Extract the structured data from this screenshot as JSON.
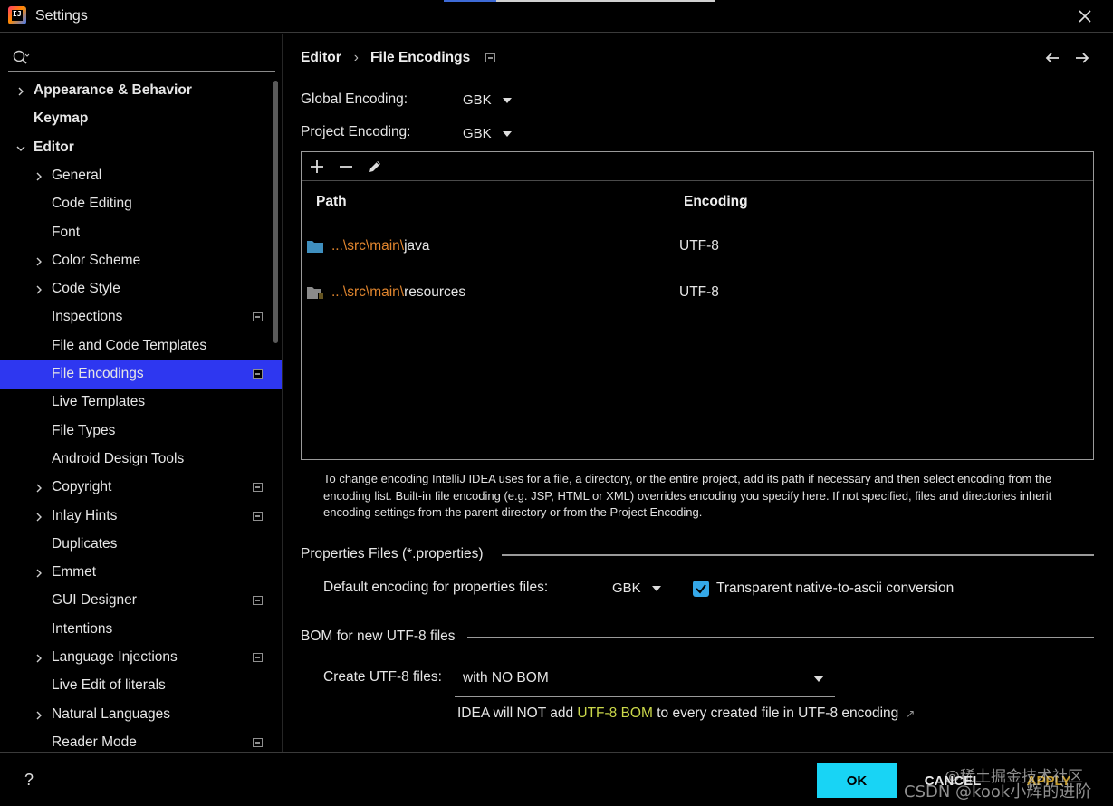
{
  "window": {
    "title": "Settings",
    "close_icon": "close-icon",
    "logo_text": "IJ"
  },
  "search": {
    "value": "",
    "placeholder": ""
  },
  "sidebar": {
    "items": [
      {
        "label": "Appearance & Behavior",
        "bold": true,
        "expandable": true,
        "expanded": false,
        "level": 0,
        "badge": false,
        "selected": false
      },
      {
        "label": "Keymap",
        "bold": true,
        "expandable": false,
        "level": 0,
        "badge": false,
        "selected": false
      },
      {
        "label": "Editor",
        "bold": true,
        "expandable": true,
        "expanded": true,
        "level": 0,
        "badge": false,
        "selected": false
      },
      {
        "label": "General",
        "expandable": true,
        "level": 1,
        "badge": false,
        "selected": false
      },
      {
        "label": "Code Editing",
        "expandable": false,
        "level": 1,
        "badge": false,
        "selected": false
      },
      {
        "label": "Font",
        "expandable": false,
        "level": 1,
        "badge": false,
        "selected": false
      },
      {
        "label": "Color Scheme",
        "expandable": true,
        "level": 1,
        "badge": false,
        "selected": false
      },
      {
        "label": "Code Style",
        "expandable": true,
        "level": 1,
        "badge": false,
        "selected": false
      },
      {
        "label": "Inspections",
        "expandable": false,
        "level": 1,
        "badge": true,
        "selected": false
      },
      {
        "label": "File and Code Templates",
        "expandable": false,
        "level": 1,
        "badge": false,
        "selected": false
      },
      {
        "label": "File Encodings",
        "expandable": false,
        "level": 1,
        "badge": true,
        "selected": true
      },
      {
        "label": "Live Templates",
        "expandable": false,
        "level": 1,
        "badge": false,
        "selected": false
      },
      {
        "label": "File Types",
        "expandable": false,
        "level": 1,
        "badge": false,
        "selected": false
      },
      {
        "label": "Android Design Tools",
        "expandable": false,
        "level": 1,
        "badge": false,
        "selected": false
      },
      {
        "label": "Copyright",
        "expandable": true,
        "level": 1,
        "badge": true,
        "selected": false
      },
      {
        "label": "Inlay Hints",
        "expandable": true,
        "level": 1,
        "badge": true,
        "selected": false
      },
      {
        "label": "Duplicates",
        "expandable": false,
        "level": 1,
        "badge": false,
        "selected": false
      },
      {
        "label": "Emmet",
        "expandable": true,
        "level": 1,
        "badge": false,
        "selected": false
      },
      {
        "label": "GUI Designer",
        "expandable": false,
        "level": 1,
        "badge": true,
        "selected": false
      },
      {
        "label": "Intentions",
        "expandable": false,
        "level": 1,
        "badge": false,
        "selected": false
      },
      {
        "label": "Language Injections",
        "expandable": true,
        "level": 1,
        "badge": true,
        "selected": false
      },
      {
        "label": "Live Edit of literals",
        "expandable": false,
        "level": 1,
        "badge": false,
        "selected": false
      },
      {
        "label": "Natural Languages",
        "expandable": true,
        "level": 1,
        "badge": false,
        "selected": false
      },
      {
        "label": "Reader Mode",
        "expandable": false,
        "level": 1,
        "badge": true,
        "selected": false
      }
    ]
  },
  "breadcrumb": {
    "parent": "Editor",
    "separator": "›",
    "current": "File Encodings"
  },
  "encoding": {
    "global_label": "Global Encoding:",
    "global_value": "GBK",
    "project_label": "Project Encoding:",
    "project_value": "GBK"
  },
  "table": {
    "toolbar": [
      "add-icon",
      "remove-icon",
      "edit-icon"
    ],
    "columns": {
      "path": "Path",
      "encoding": "Encoding"
    },
    "rows": [
      {
        "path_prefix": "...\\src\\main\\",
        "path_name": "java",
        "encoding": "UTF-8",
        "icon": "folder-icon"
      },
      {
        "path_prefix": "...\\src\\main\\",
        "path_name": "resources",
        "encoding": "UTF-8",
        "icon": "resources-folder-icon"
      }
    ]
  },
  "help": {
    "text": "To change encoding IntelliJ IDEA uses for a file, a directory, or the entire project, add its path if necessary and then select encoding from the encoding list. Built-in file encoding (e.g. JSP, HTML or XML) overrides encoding you specify here. If not specified, files and directories inherit encoding settings from the parent directory or from the Project Encoding."
  },
  "properties": {
    "section_title": "Properties Files (*.properties)",
    "default_label": "Default encoding for properties files:",
    "default_value": "GBK",
    "transparent_label": "Transparent native-to-ascii conversion",
    "transparent_checked": true
  },
  "bom": {
    "section_title": "BOM for new UTF-8 files",
    "create_label": "Create UTF-8 files:",
    "create_value": "with NO BOM",
    "note_prefix": "IDEA will NOT add ",
    "note_highlight": "UTF-8 BOM",
    "note_suffix": " to every created file in UTF-8 encoding",
    "note_link_icon": "↗"
  },
  "footer": {
    "help": "?",
    "ok": "OK",
    "cancel": "CANCEL",
    "apply": "APPLY"
  },
  "watermarks": {
    "top": "@稀土掘金技术社区",
    "bottom": "CSDN @kook小辉的进阶"
  },
  "colors": {
    "selection": "#2e37f0",
    "ok_button": "#18d4f5",
    "path_prefix": "#e0852e",
    "highlight": "#cbd84a",
    "checkbox": "#35a8e8"
  }
}
